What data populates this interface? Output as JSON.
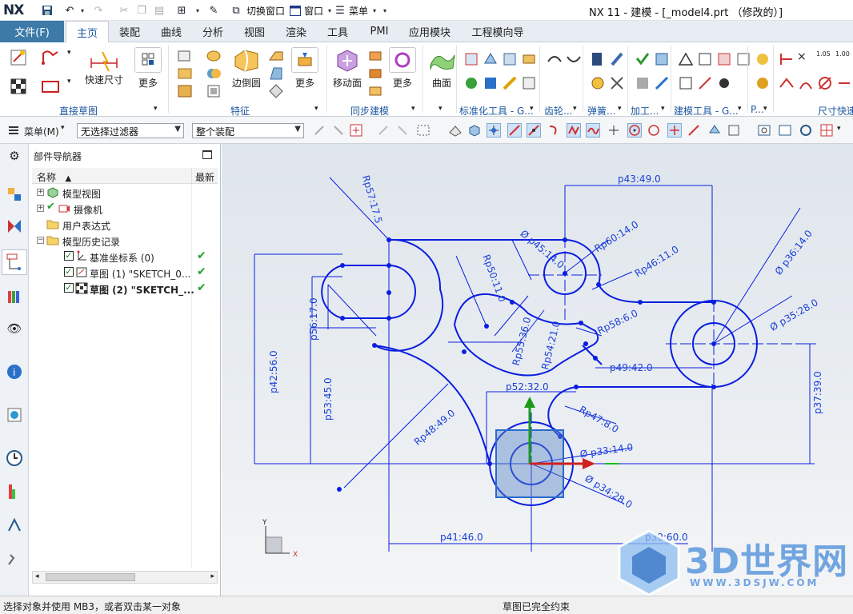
{
  "title_bar": {
    "logo": "NX",
    "window_switch": "切换窗口",
    "window_menu": "窗口",
    "menu": "菜单",
    "window_title": "NX 11 - 建模 - [_model4.prt （修改的）]"
  },
  "ribbon_tabs": [
    {
      "label": "文件(F)"
    },
    {
      "label": "主页"
    },
    {
      "label": "装配"
    },
    {
      "label": "曲线"
    },
    {
      "label": "分析"
    },
    {
      "label": "视图"
    },
    {
      "label": "渲染"
    },
    {
      "label": "工具"
    },
    {
      "label": "PMI"
    },
    {
      "label": "应用模块"
    },
    {
      "label": "工程模向导"
    }
  ],
  "ribbon": {
    "quick_dim": "快速尺寸",
    "more": "更多",
    "edge_blend": "边倒圆",
    "move_face": "移动面",
    "surface": "曲面",
    "groups": {
      "direct_sketch": "直接草图",
      "feature": "特征",
      "sync_modeling": "同步建模",
      "std_parts": "标准化工具 - G...",
      "gear": "齿轮...",
      "spring": "弹簧...",
      "machining": "加工...",
      "build_tool": "建模工具 - G...",
      "p": "P...",
      "dim_quick": "尺寸快速"
    }
  },
  "toolbar2": {
    "menu": "菜单(M)",
    "filter": "无选择过滤器",
    "scope": "整个装配"
  },
  "navigator": {
    "title": "部件导航器",
    "col_name": "名称",
    "col_latest": "最新",
    "rows": [
      {
        "label": "模型视图"
      },
      {
        "label": "摄像机"
      },
      {
        "label": "用户表达式"
      },
      {
        "label": "模型历史记录"
      },
      {
        "label": "基准坐标系 (0)"
      },
      {
        "label": "草图 (1) \"SKETCH_0..."
      },
      {
        "label": "草图 (2) \"SKETCH_..."
      }
    ]
  },
  "sketch_dims": {
    "p57": "Rp57:17.5",
    "p43": "p43:49.0",
    "p60": "Rp60:14.0",
    "p45": "Ø p45:14.0",
    "p46": "Rp46:11.0",
    "p36": "Ø p36:14.0",
    "p56": "p56:17.0",
    "p50": "Rp50:11.0",
    "p58": "Rp58:6.0",
    "p55": "Rp55:36.0",
    "p54": "Rp54:21.0",
    "p35": "Ø p35:28.0",
    "p49": "p49:42.0",
    "p42": "p42:56.0",
    "p53": "p53:45.0",
    "p52": "p52:32.0",
    "p37": "p37:39.0",
    "p48": "Rp48:49.0",
    "p47": "Rp47:8.0",
    "p33": "Ø p33:14.0",
    "p34": "Ø p34:28.0",
    "p41": "p41:46.0",
    "p39": "p39:60.0"
  },
  "triad": {
    "x": "X",
    "y": "Y"
  },
  "status": {
    "left": "选择对象并使用 MB3，或者双击某一对象",
    "center": "草图已完全约束"
  },
  "watermark": {
    "text": "3D世界网",
    "url": "WWW.3DSJW.COM"
  },
  "colors": {
    "sketch": "#0a1ee0",
    "dimension": "#1a3fd8",
    "file_tab": "#3d7aa8",
    "accent_tab": "#1d58a0"
  }
}
